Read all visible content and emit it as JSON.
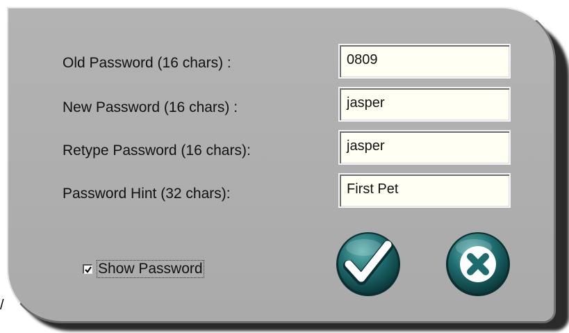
{
  "form": {
    "old_password": {
      "label": "Old Password (16 chars) :",
      "value": "0809"
    },
    "new_password": {
      "label": "New Password (16 chars) :",
      "value": "jasper"
    },
    "retype_password": {
      "label": "Retype Password (16 chars):",
      "value": "jasper"
    },
    "password_hint": {
      "label": "Password Hint (32 chars):",
      "value": "First Pet"
    }
  },
  "show_password": {
    "label": "Show Password",
    "checked": true
  },
  "buttons": {
    "ok_icon": "checkmark-icon",
    "cancel_icon": "close-icon",
    "accent": "#1e6b6e"
  }
}
